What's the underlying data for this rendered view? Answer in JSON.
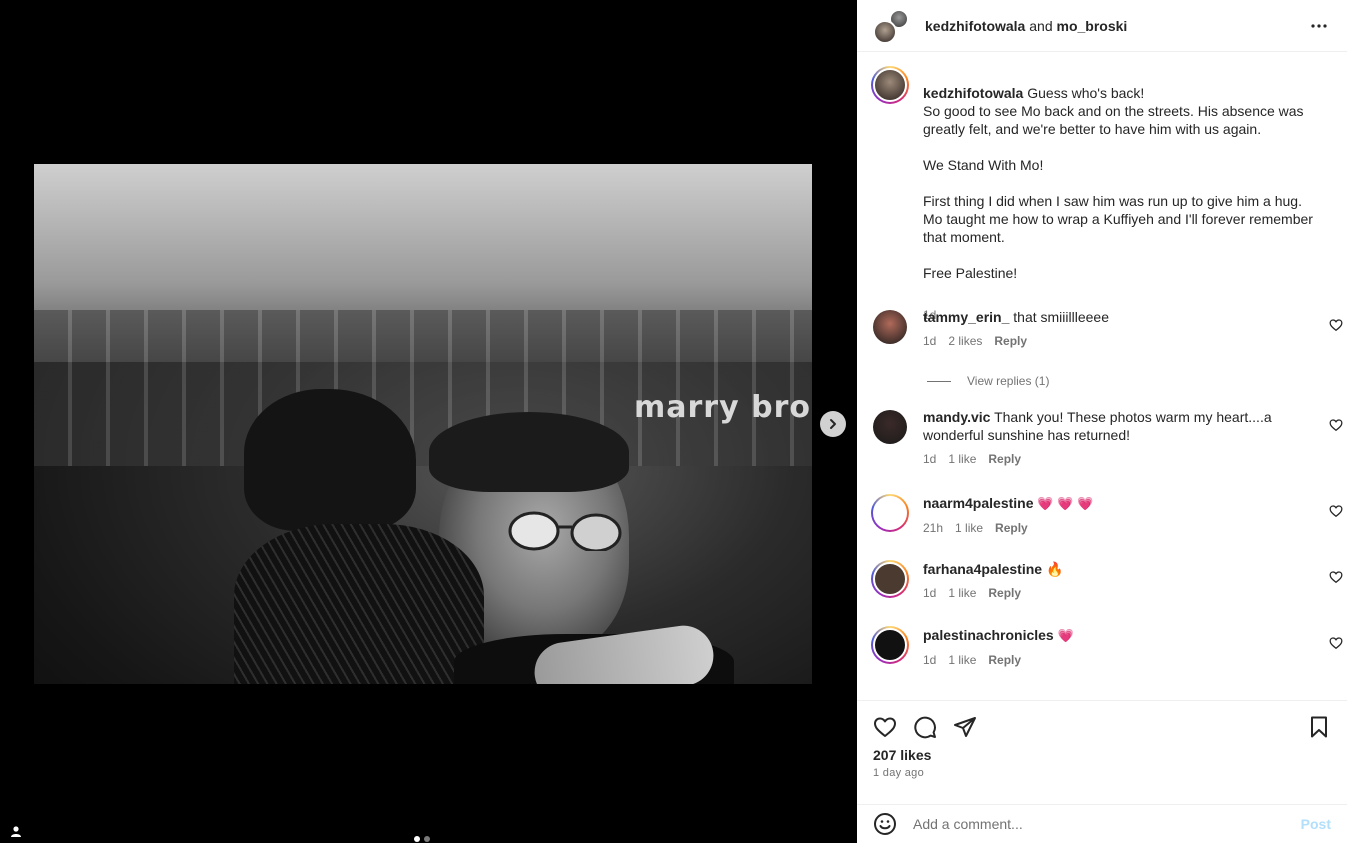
{
  "header": {
    "user1": "kedzhifotowala",
    "conjunction": "and",
    "user2": "mo_broski"
  },
  "photo": {
    "sign_text": "marry bro"
  },
  "caption": {
    "username": "kedzhifotowala",
    "text": "Guess who's back!\nSo good to see Mo back and on the streets. His absence was greatly felt, and we're better to have him with us again.\n\nWe Stand With Mo!\n\nFirst thing I did when I saw him was run up to give him a hug. Mo taught me how to wrap a Kuffiyeh and I'll forever remember that moment.\n\nFree Palestine!",
    "time": "1d"
  },
  "comments": [
    {
      "username": "tammy_erin_",
      "text": "that smiiillleeee",
      "time": "1d",
      "likes": "2 likes",
      "reply": "Reply",
      "ring": false,
      "avatar_color": "#b06a5a"
    },
    {
      "username": "mandy.vic",
      "text": "Thank you! These photos warm my heart....a wonderful sunshine has returned!",
      "time": "1d",
      "likes": "1 like",
      "reply": "Reply",
      "ring": false,
      "avatar_color": "#3a2a28"
    },
    {
      "username": "naarm4palestine",
      "text": "💗 💗 💗",
      "time": "21h",
      "likes": "1 like",
      "reply": "Reply",
      "ring": true,
      "avatar_color": "#ffffff"
    },
    {
      "username": "farhana4palestine",
      "text": "🔥",
      "time": "1d",
      "likes": "1 like",
      "reply": "Reply",
      "ring": true,
      "avatar_color": "#4a3a30"
    },
    {
      "username": "palestinachronicles",
      "text": "💗",
      "time": "1d",
      "likes": "1 like",
      "reply": "Reply",
      "ring": true,
      "avatar_color": "#111111"
    }
  ],
  "view_replies": "View replies (1)",
  "likes_count": "207 likes",
  "posted_ago": "1 day ago",
  "add_comment": {
    "placeholder": "Add a comment...",
    "post_label": "Post"
  },
  "colors": {
    "accent": "#0095f6",
    "post_disabled": "#b2dffc",
    "heart_emoji": "#e8326b"
  },
  "carousel": {
    "slide_count": 2,
    "active_index": 0
  }
}
